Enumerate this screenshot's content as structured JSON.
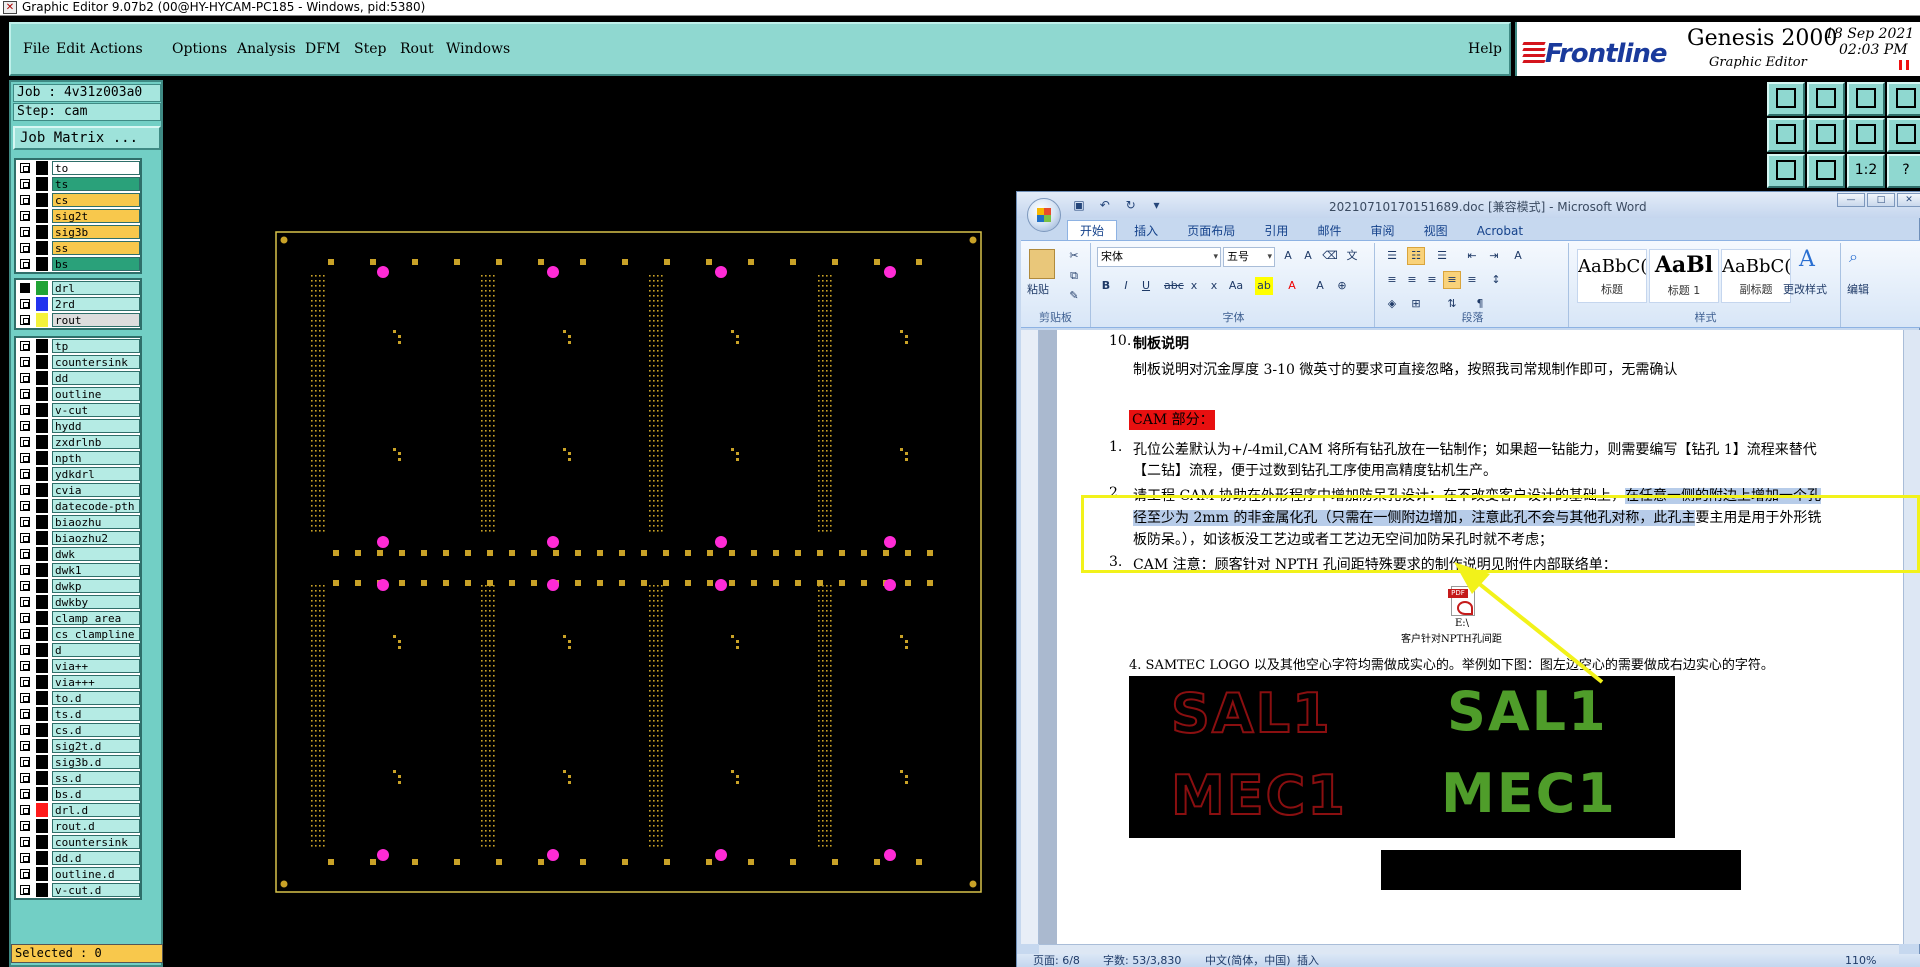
{
  "genesis": {
    "window_title": "Graphic Editor 9.07b2 (00@HY-HYCAM-PC185 - Windows, pid:5380)",
    "menu": [
      "File",
      "Edit",
      "Actions",
      "Options",
      "Analysis",
      "DFM",
      "Step",
      "Rout",
      "Windows"
    ],
    "help": "Help",
    "brand": {
      "logo": "Frontline",
      "product": "Genesis 2000",
      "subtitle": "Graphic Editor",
      "date": "18 Sep 2021",
      "time": "02:03 PM"
    },
    "job_label": "Job : 4v31z003a0",
    "step_label": "Step: cam",
    "job_matrix_button": "Job Matrix ...",
    "selected_label": "Selected : 0",
    "colors": {
      "panel": "#72cfc5",
      "pad_yellow": "#c9a227",
      "pad_magenta": "#ff2bd6",
      "board_outline": "#d8c24a"
    },
    "layers_group1": [
      {
        "name": "to",
        "color": "#ffffff"
      },
      {
        "name": "ts",
        "color": "#2aa17a"
      },
      {
        "name": "cs",
        "color": "#f8c84c"
      },
      {
        "name": "sig2t",
        "color": "#f8c84c"
      },
      {
        "name": "sig3b",
        "color": "#f8c84c"
      },
      {
        "name": "ss",
        "color": "#f8c84c"
      },
      {
        "name": "bs",
        "color": "#2aa17a"
      }
    ],
    "layers_group2": [
      {
        "name": "drl",
        "color": "#b5ebe4",
        "swatch": "#21a335",
        "active": true
      },
      {
        "name": "2rd",
        "color": "#b5ebe4",
        "swatch": "#2233ee"
      },
      {
        "name": "rout",
        "color": "#dddddd",
        "swatch": "#f4f23a"
      }
    ],
    "layers_group3": [
      {
        "name": "tp"
      },
      {
        "name": "countersink"
      },
      {
        "name": "dd"
      },
      {
        "name": "outline"
      },
      {
        "name": "v-cut"
      },
      {
        "name": "hydd"
      },
      {
        "name": "zxdrlnb"
      },
      {
        "name": "npth"
      },
      {
        "name": "ydkdrl"
      },
      {
        "name": "cvia"
      },
      {
        "name": "datecode-pth"
      },
      {
        "name": "biaozhu"
      },
      {
        "name": "biaozhu2"
      },
      {
        "name": "dwk"
      },
      {
        "name": "dwk1"
      },
      {
        "name": "dwkp"
      },
      {
        "name": "dwkby"
      },
      {
        "name": "clamp_area"
      },
      {
        "name": "cs_clampline"
      },
      {
        "name": "d"
      },
      {
        "name": "via++"
      },
      {
        "name": "via+++"
      },
      {
        "name": "to.d"
      },
      {
        "name": "ts.d"
      },
      {
        "name": "cs.d"
      },
      {
        "name": "sig2t.d"
      },
      {
        "name": "sig3b.d"
      },
      {
        "name": "ss.d"
      },
      {
        "name": "bs.d"
      },
      {
        "name": "drl.d",
        "swatch": "#ff1a1a"
      },
      {
        "name": "rout.d"
      },
      {
        "name": "countersink"
      },
      {
        "name": "dd.d"
      },
      {
        "name": "outline.d"
      },
      {
        "name": "v-cut.d"
      }
    ],
    "tools": [
      "1:2",
      "?"
    ]
  },
  "word": {
    "title": "20210710170151689.doc [兼容模式] - Microsoft Word",
    "tabs": [
      "开始",
      "插入",
      "页面布局",
      "引用",
      "邮件",
      "审阅",
      "视图",
      "Acrobat"
    ],
    "ribbon": {
      "paste": "粘贴",
      "clipboard": "剪贴板",
      "font_name": "宋体",
      "font_size": "五号",
      "font_group": "字体",
      "paragraph_group": "段落",
      "styles_group": "样式",
      "styles": [
        {
          "preview": "AaBbC(",
          "label": "标题"
        },
        {
          "preview": "AaBl",
          "label": "标题 1"
        },
        {
          "preview": "AaBbC(",
          "label": "副标题"
        }
      ],
      "change_styles": "更改样式",
      "edit": "编辑"
    },
    "doc": {
      "item10_num": "10.",
      "item10_title": "制板说明",
      "item10_body": "制板说明对沉金厚度 3-10 微英寸的要求可直接忽略，按照我司常规制作即可，无需确认",
      "cam_heading": "CAM 部分：",
      "item1_num": "1.",
      "item1_line1": "孔位公差默认为+/-4mil,CAM 将所有钻孔放在一钻制作；如果超一钻能力，则需要编写【钻孔 1】流程来替代",
      "item1_line2": "【二钻】流程，便于过数到钻孔工序使用高精度钻机生产。",
      "item2_num": "2.",
      "item2_line1a": "请工程 CAM 协助在外形程序中增加防呆孔设计：在不改变客户设计的基础上，",
      "item2_line1b": "在任意一侧的附边上增加一个孔",
      "item2_line2a": "径至少为 2mm 的非金属化孔（只需在一侧附边增加，注意此孔不会与其他孔对称，此孔主",
      "item2_line2b": "要主用是用于外形铣",
      "item2_line3": "板防呆。），如该板没工艺边或者工艺边无空间加防呆孔时就不考虑；",
      "item3_num": "3.",
      "item3_body": "CAM 注意：顾客针对 NPTH 孔间距特殊要求的制作说明见附件内部联络单：",
      "attachment_path": "E:\\",
      "attachment_name": "客户针对NPTH孔间距",
      "item4": "4. SAMTEC LOGO 以及其他空心字符均需做成实心的。举例如下图：图左边空心的需要做成右边实心的字符。",
      "logo_left_top": "SAL1",
      "logo_right_top": "SAL1",
      "logo_left_bottom": "MEC1",
      "logo_right_bottom": "MEC1"
    },
    "status": {
      "page": "页面: 6/8",
      "words": "字数: 53/3,830",
      "lang": "中文(简体，中国)",
      "mode": "插入",
      "zoom": "110%"
    }
  }
}
